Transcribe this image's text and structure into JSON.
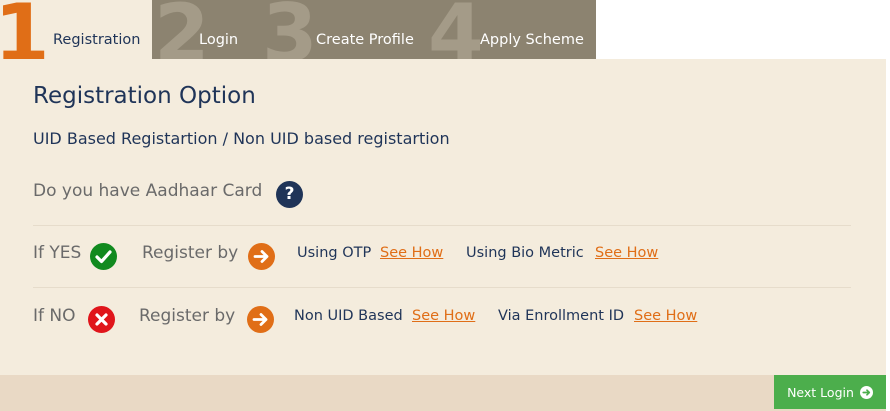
{
  "tabs": [
    {
      "number": "1",
      "label": "Registration",
      "active": true
    },
    {
      "number": "2",
      "label": "Login",
      "active": false
    },
    {
      "number": "3",
      "label": "Create Profile",
      "active": false
    },
    {
      "number": "4",
      "label": "Apply Scheme",
      "active": false
    }
  ],
  "main": {
    "title": "Registration Option",
    "subtitle": "UID Based Registartion / Non UID based registartion",
    "question": "Do you have Aadhaar Card",
    "help_icon": "question-circle-icon",
    "rows": [
      {
        "label": "If YES",
        "status_icon": "check-circle-icon",
        "register_by": "Register by",
        "options": [
          {
            "text": "Using OTP",
            "link": "See How"
          },
          {
            "text": "Using Bio Metric",
            "link": "See How"
          }
        ]
      },
      {
        "label": "If NO",
        "status_icon": "cross-circle-icon",
        "register_by": "Register by",
        "options": [
          {
            "text": "Non UID Based",
            "link": "See How"
          },
          {
            "text": "Via Enrollment ID",
            "link": "See How"
          }
        ]
      }
    ]
  },
  "footer": {
    "next_button_label": "Next Login",
    "next_button_icon": "arrow-circle-right-icon"
  },
  "colors": {
    "active_tab_number": "#e06e17",
    "inactive_tab_bg": "#8c8370",
    "panel_bg": "#f4ecdd",
    "heading_text": "#1f3458",
    "link": "#e06e17",
    "yes_green": "#118a1f",
    "no_red": "#e0151b",
    "next_button": "#4cae4c"
  }
}
